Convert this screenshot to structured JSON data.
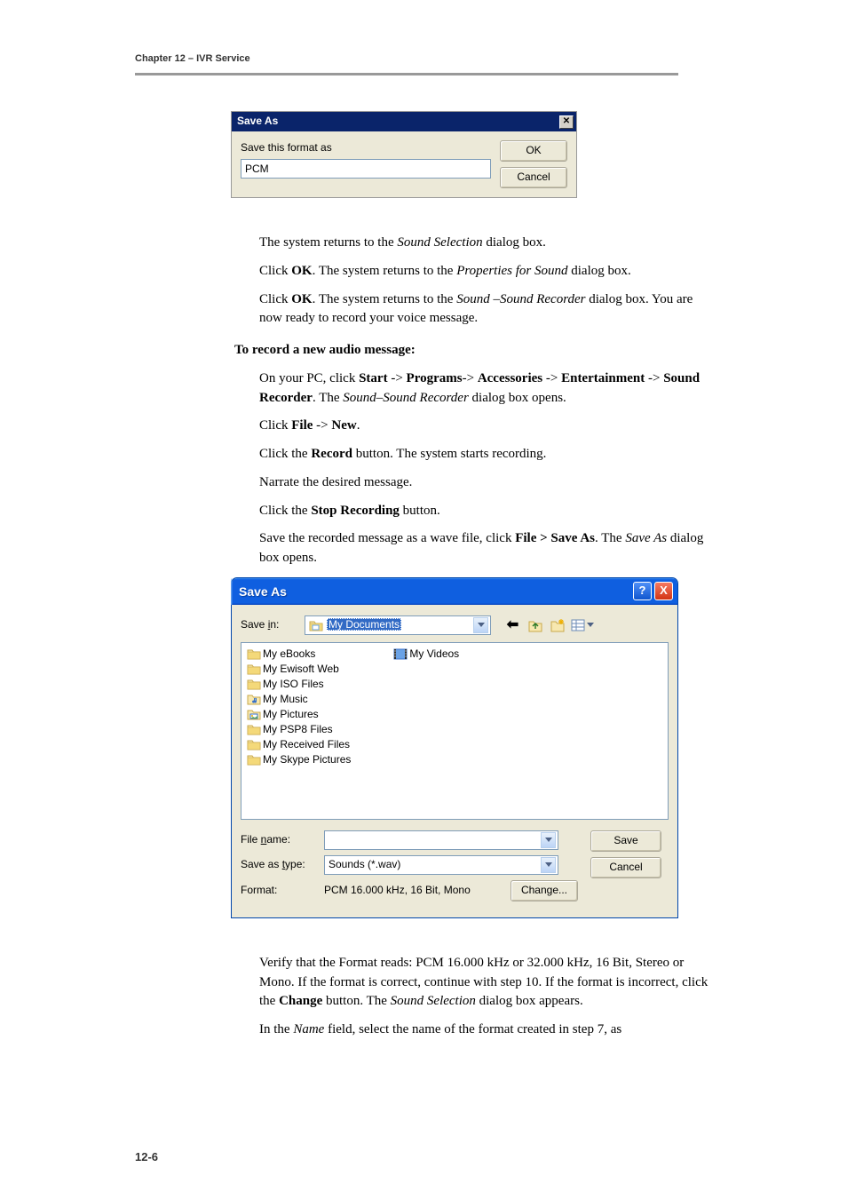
{
  "header": "Chapter 12 – IVR Service",
  "footer": "12-6",
  "dlg_small": {
    "title": "Save As",
    "close_glyph": "✕",
    "label": "Save this format as",
    "value": "PCM",
    "ok": "OK",
    "cancel": "Cancel"
  },
  "paras": {
    "p1_a": "The system returns to the ",
    "p1_i": "Sound Selection",
    "p1_b": " dialog box.",
    "p2_a": "Click ",
    "p2_bold": "OK",
    "p2_b": ". The system returns to the ",
    "p2_i": "Properties for Sound",
    "p2_c": " dialog box.",
    "p3_a": "Click ",
    "p3_bold": "OK",
    "p3_b": ". The system returns to the ",
    "p3_i": "Sound –Sound Recorder",
    "p3_c": " dialog box. You are now ready to record your voice message.",
    "sec_head": "To record a new audio message:",
    "p4_a": "On your PC, click ",
    "p4_b1": "Start",
    "p4_ar": " -> ",
    "p4_b2": "Programs",
    "p4_ar2": "-> ",
    "p4_b3": "Accessories",
    "p4_b4": "Entertainment",
    "p4_b5": "Sound Recorder",
    "p4_e": ". The ",
    "p4_i": "Sound–Sound Recorder",
    "p4_f": " dialog box opens.",
    "p5_a": "Click ",
    "p5_b1": "File",
    "p5_ar": " -> ",
    "p5_b2": "New",
    "p5_c": ".",
    "p6_a": "Click the ",
    "p6_b": "Record",
    "p6_c": " button. The system starts recording.",
    "p7": "Narrate the desired message.",
    "p8_a": "Click the ",
    "p8_b": "Stop Recording",
    "p8_c": " button.",
    "p9_a": "Save the recorded message as a wave file, click ",
    "p9_b": "File > Save As",
    "p9_c": ". The ",
    "p9_i": "Save As",
    "p9_d": " dialog box opens.",
    "p10_a": "Verify that the Format reads: PCM 16.000 kHz or 32.000 kHz, 16 Bit, Stereo or Mono. If the format is correct, continue with step 10. If the format is incorrect, click the ",
    "p10_b": "Change",
    "p10_c": " button. The ",
    "p10_i": "Sound Selection",
    "p10_d": " dialog box appears.",
    "p11_a": "In the ",
    "p11_i": "Name",
    "p11_b": " field, select the name of the format created in step 7, as"
  },
  "dlg_big": {
    "title": "Save As",
    "help_glyph": "?",
    "close_glyph": "X",
    "savein_label_pre": "Save ",
    "savein_label_u": "i",
    "savein_label_post": "n:",
    "savein_value": "My Documents",
    "files_col1": [
      "My eBooks",
      "My Ewisoft Web",
      "My ISO Files",
      "My Music",
      "My Pictures",
      "My PSP8 Files",
      "My Received Files",
      "My Skype Pictures"
    ],
    "files_col2": [
      "My Videos"
    ],
    "filename_label_pre": "File ",
    "filename_label_u": "n",
    "filename_label_post": "ame:",
    "filename_value": "",
    "saveastype_label_pre": "Save as ",
    "saveastype_label_u": "t",
    "saveastype_label_post": "ype:",
    "saveastype_value": "Sounds (*.wav)",
    "format_label": "Format:",
    "format_value": "PCM 16.000 kHz, 16 Bit, Mono",
    "save_btn": "Save",
    "cancel_btn": "Cancel",
    "change_btn": "Change..."
  }
}
